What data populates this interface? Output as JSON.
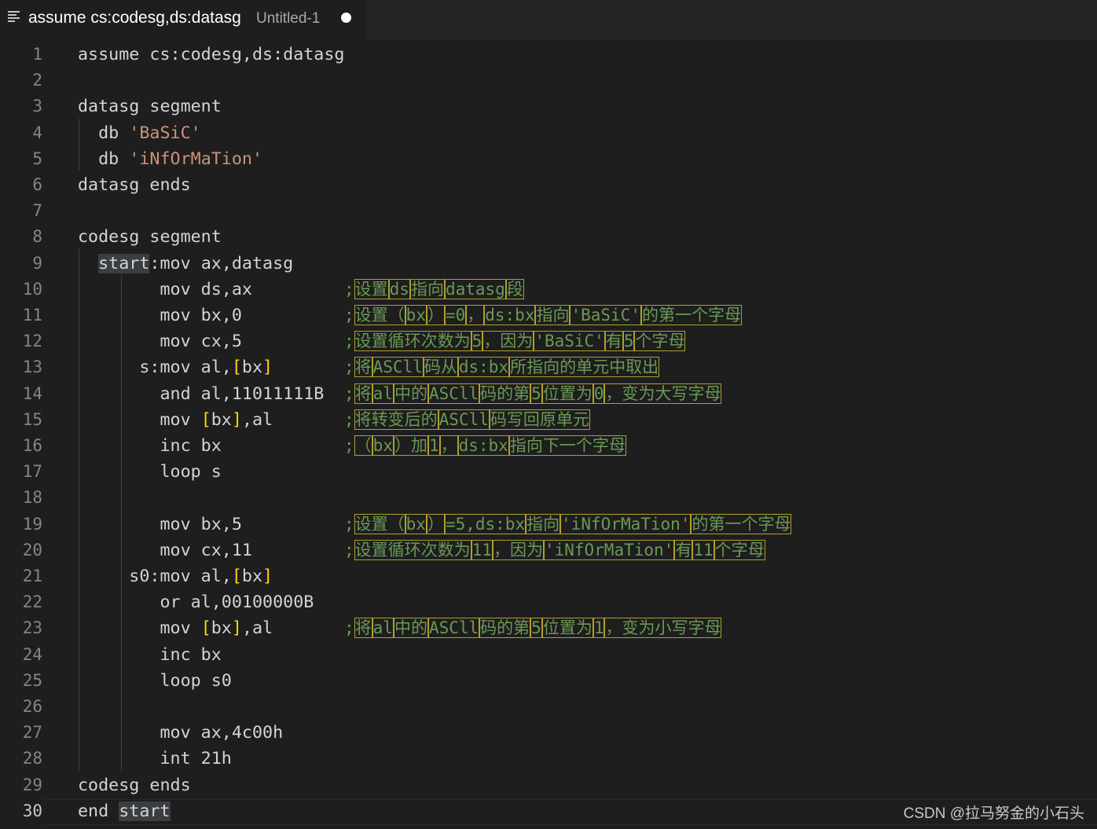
{
  "tab": {
    "title": "assume cs:codesg,ds:datasg",
    "description": "Untitled-1",
    "icon": "text-lines-icon"
  },
  "editor": {
    "current_line": 30,
    "lines": [
      {
        "num": "1",
        "code": "assume cs:codesg,ds:datasg",
        "comment": []
      },
      {
        "num": "2",
        "code": "",
        "comment": []
      },
      {
        "num": "3",
        "code": "datasg segment",
        "comment": []
      },
      {
        "num": "4",
        "code": "  db 'BaSiC'",
        "comment": []
      },
      {
        "num": "5",
        "code": "  db 'iNfOrMaTion'",
        "comment": []
      },
      {
        "num": "6",
        "code": "datasg ends",
        "comment": []
      },
      {
        "num": "7",
        "code": "",
        "comment": []
      },
      {
        "num": "8",
        "code": "codesg segment",
        "comment": []
      },
      {
        "num": "9",
        "code": "  start:mov ax,datasg",
        "comment": []
      },
      {
        "num": "10",
        "code": "        mov ds,ax",
        "comment": [
          ";",
          "设置",
          "ds",
          "指向",
          "datasg",
          "段"
        ]
      },
      {
        "num": "11",
        "code": "        mov bx,0",
        "comment": [
          ";",
          "设置（",
          "bx",
          "）",
          "=0",
          "，",
          "ds:bx",
          "指向",
          "'BaSiC'",
          "的第一个字母"
        ]
      },
      {
        "num": "12",
        "code": "        mov cx,5",
        "comment": [
          ";",
          "设置循环次数为",
          "5",
          "，因为",
          "'BaSiC'",
          "有",
          "5",
          "个字母"
        ]
      },
      {
        "num": "13",
        "code": "      s:mov al,[bx]",
        "comment": [
          ";",
          "将",
          "ASCll",
          "码从",
          "ds:bx",
          "所指向的单元中取出"
        ]
      },
      {
        "num": "14",
        "code": "        and al,11011111B",
        "comment": [
          ";",
          "将",
          "al",
          "中的",
          "ASCll",
          "码的第",
          "5",
          "位置为",
          "0",
          "，变为大写字母"
        ]
      },
      {
        "num": "15",
        "code": "        mov [bx],al",
        "comment": [
          ";",
          "将转变后的",
          "ASCll",
          "码写回原单元"
        ]
      },
      {
        "num": "16",
        "code": "        inc bx",
        "comment": [
          ";",
          "（",
          "bx",
          "）加",
          "1",
          "，",
          "ds:bx",
          "指向下一个字母"
        ]
      },
      {
        "num": "17",
        "code": "        loop s",
        "comment": []
      },
      {
        "num": "18",
        "code": "",
        "comment": []
      },
      {
        "num": "19",
        "code": "        mov bx,5",
        "comment": [
          ";",
          "设置（",
          "bx",
          "）",
          "=5,ds:bx",
          "指向",
          "'iNfOrMaTion'",
          "的第一个字母"
        ]
      },
      {
        "num": "20",
        "code": "        mov cx,11",
        "comment": [
          ";",
          "设置循环次数为",
          "11",
          "，因为",
          "'iNfOrMaTion'",
          "有",
          "11",
          "个字母"
        ]
      },
      {
        "num": "21",
        "code": "     s0:mov al,[bx]",
        "comment": []
      },
      {
        "num": "22",
        "code": "        or al,00100000B",
        "comment": []
      },
      {
        "num": "23",
        "code": "        mov [bx],al",
        "comment": [
          ";",
          "将",
          "al",
          "中的",
          "ASCll",
          "码的第",
          "5",
          "位置为",
          "1",
          "，变为小写字母"
        ]
      },
      {
        "num": "24",
        "code": "        inc bx",
        "comment": []
      },
      {
        "num": "25",
        "code": "        loop s0",
        "comment": []
      },
      {
        "num": "26",
        "code": "",
        "comment": []
      },
      {
        "num": "27",
        "code": "        mov ax,4c00h",
        "comment": []
      },
      {
        "num": "28",
        "code": "        int 21h",
        "comment": []
      },
      {
        "num": "29",
        "code": "codesg ends",
        "comment": []
      },
      {
        "num": "30",
        "code": "end start",
        "comment": []
      }
    ]
  },
  "watermark": "CSDN @拉马努金的小石头",
  "colors": {
    "background": "#1e1e1e",
    "text": "#d4d4d4",
    "string": "#ce9178",
    "comment": "#6a9955",
    "bracket": "#ffd700",
    "line_number": "#858585"
  }
}
